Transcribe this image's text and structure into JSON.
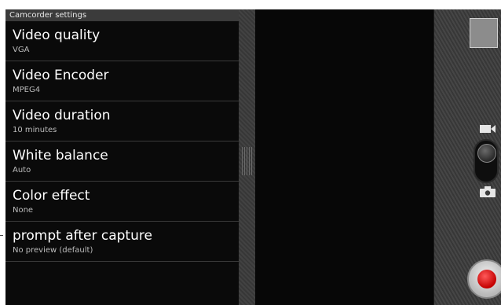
{
  "settings": {
    "header": "Camcorder settings",
    "items": [
      {
        "title": "Video quality",
        "summary": "VGA"
      },
      {
        "title": "Video Encoder",
        "summary": "MPEG4"
      },
      {
        "title": "Video duration",
        "summary": "10 minutes"
      },
      {
        "title": "White balance",
        "summary": "Auto"
      },
      {
        "title": "Color effect",
        "summary": "None"
      },
      {
        "title": "prompt after capture",
        "summary": "No preview (default)"
      }
    ]
  },
  "controls": {
    "video_mode_icon": "video-camera-icon",
    "photo_mode_icon": "camera-icon",
    "shutter_icon": "record-icon",
    "record_color": "#d10000"
  }
}
